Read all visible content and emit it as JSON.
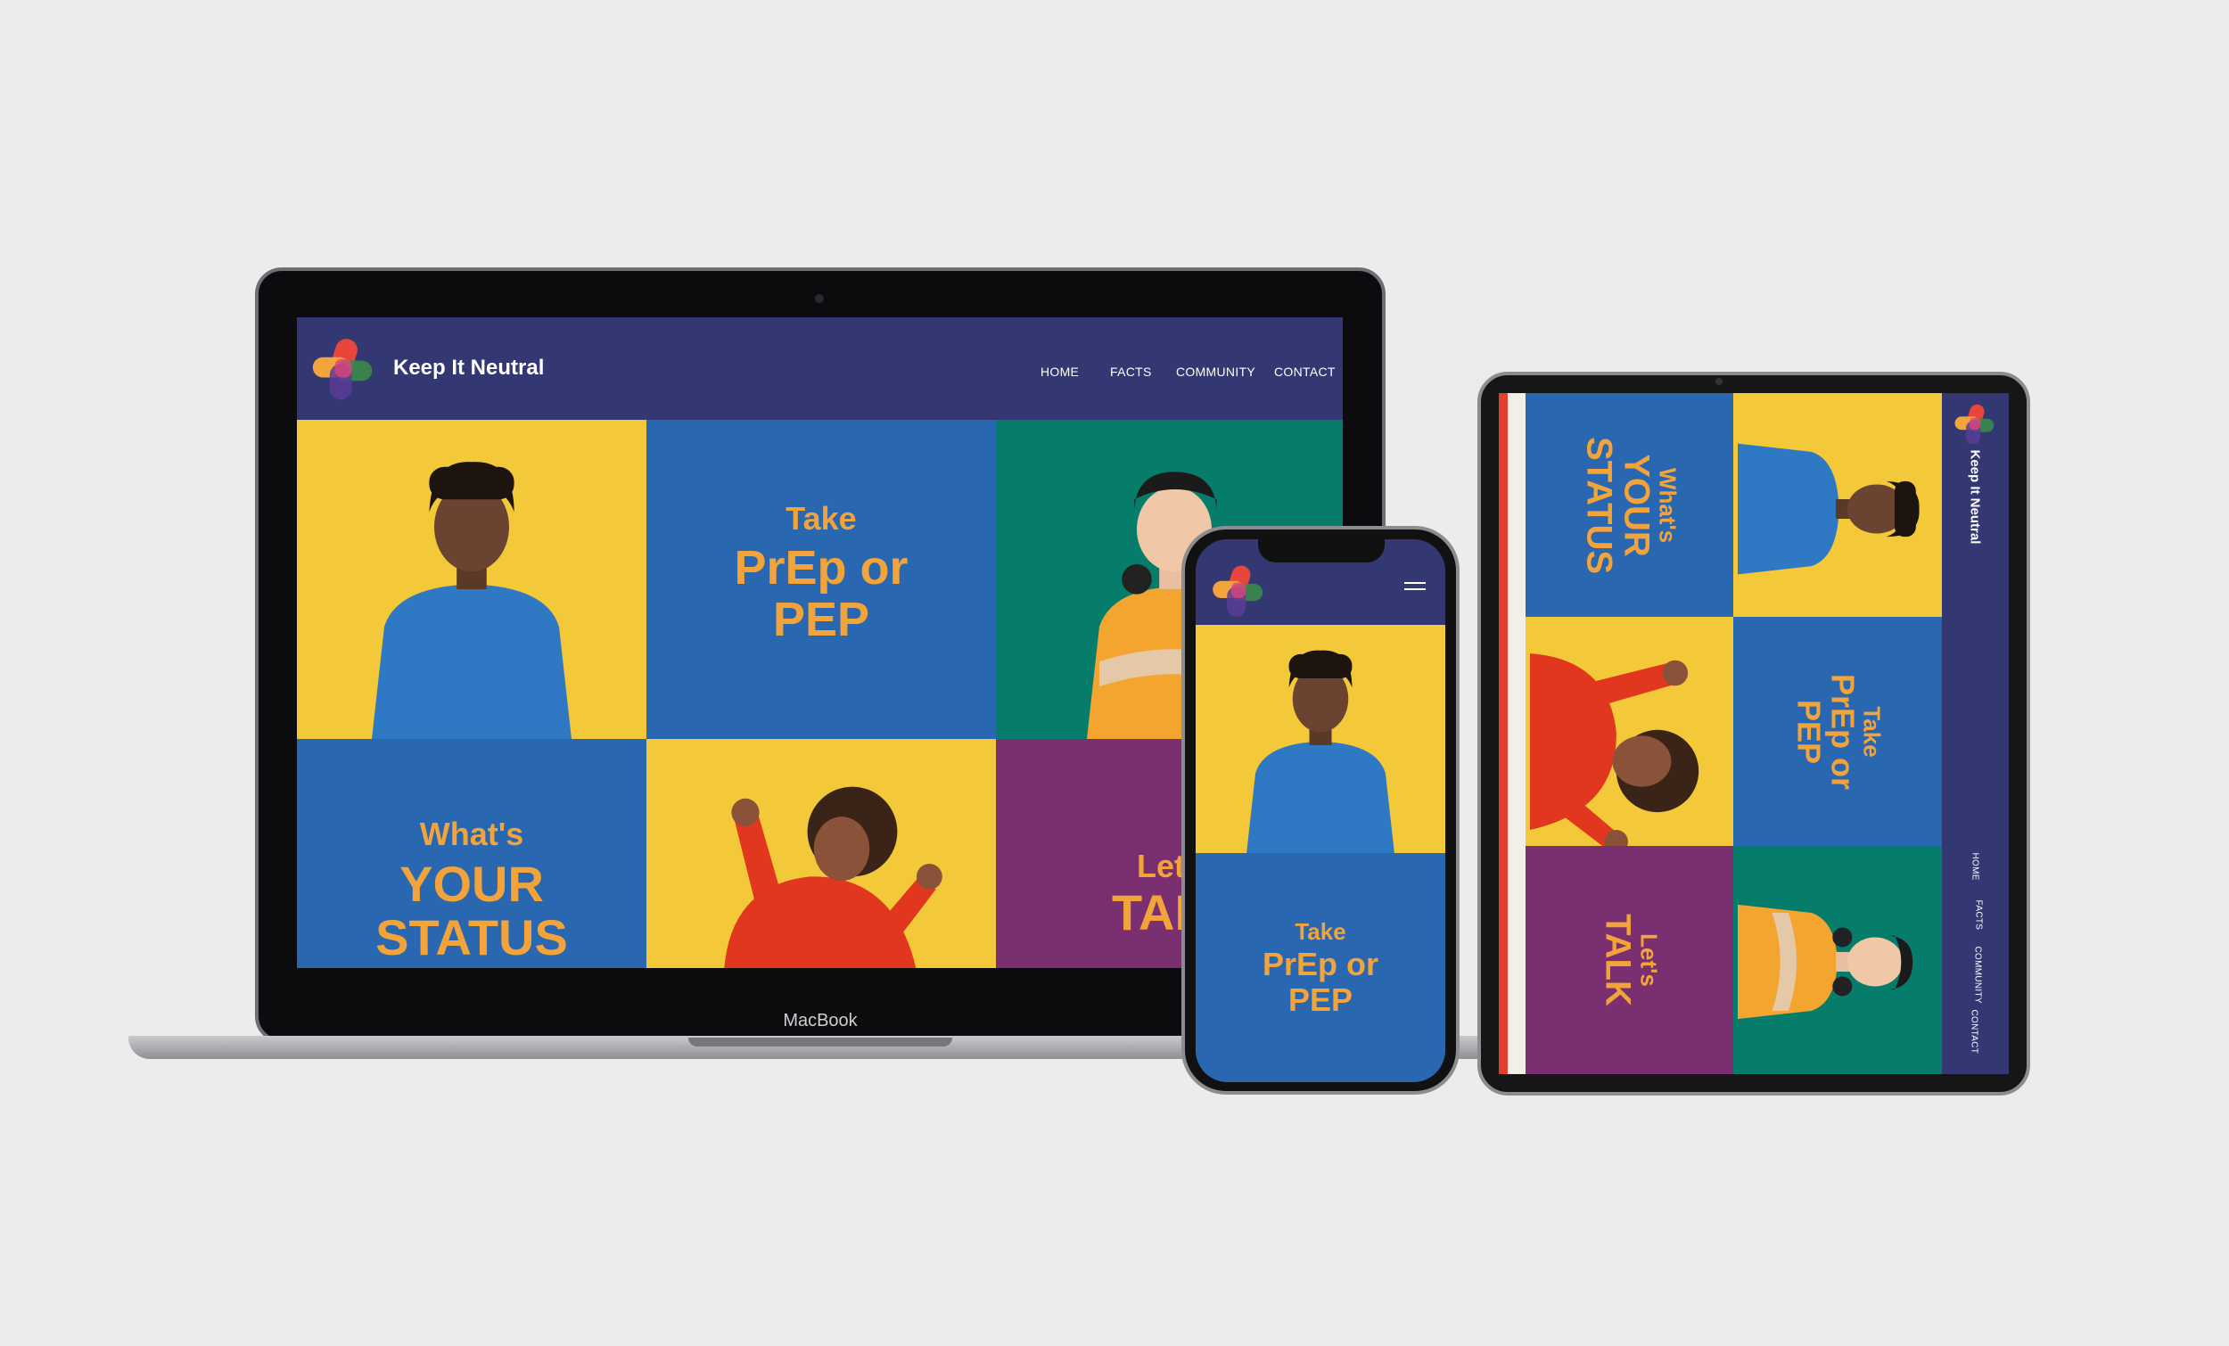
{
  "laptop": {
    "device_label": "MacBook",
    "site": {
      "brand": "Keep It Neutral",
      "nav": [
        "HOME",
        "FACTS",
        "COMMUNITY",
        "CONTACT"
      ],
      "tiles": {
        "prep_line1": "Take",
        "prep_line2": "PrEp or",
        "prep_line3": "PEP",
        "status_line1": "What's",
        "status_line2": "YOUR",
        "status_line3": "STATUS",
        "talk_line1": "Let's",
        "talk_line2": "TALK"
      }
    }
  },
  "phone": {
    "menu_icon": "hamburger-icon",
    "tiles": {
      "prep_line1": "Take",
      "prep_line2": "PrEp or",
      "prep_line3": "PEP"
    }
  },
  "tablet": {
    "brand": "Keep It Neutral",
    "nav": [
      "HOME",
      "FACTS",
      "COMMUNITY",
      "CONTACT"
    ],
    "tiles": {
      "status_line1": "What's",
      "status_line2": "YOUR",
      "status_line3": "STATUS",
      "prep_line1": "Take",
      "prep_line2": "PrEp or",
      "prep_line3": "PEP",
      "talk_line1": "Let's",
      "talk_line2": "TALK"
    }
  },
  "colors": {
    "nav_bg": "#333872",
    "yellow": "#f3c93a",
    "blue": "#2a67b1",
    "teal": "#067c6a",
    "purple": "#7a3070",
    "headline": "#f2a33a"
  }
}
